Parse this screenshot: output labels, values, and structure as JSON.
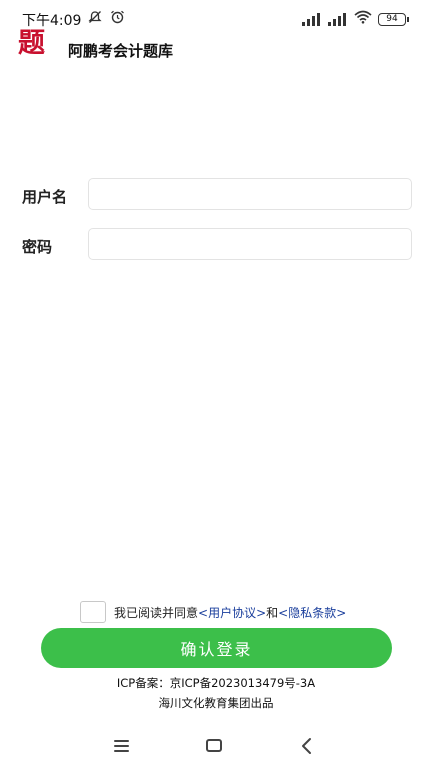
{
  "status_bar": {
    "time": "下午4:09",
    "battery": "94"
  },
  "app": {
    "logo_char": "题",
    "title": "阿鹏考会计题库"
  },
  "form": {
    "username_label": "用户名",
    "username_value": "",
    "password_label": "密码",
    "password_value": ""
  },
  "agreement": {
    "prefix": "我已阅读并同意",
    "user_agreement": "<用户协议>",
    "and": "和",
    "privacy_policy": "<隐私条款>",
    "checked": false
  },
  "confirm_label": "确认登录",
  "footer": {
    "icp": "ICP备案：京ICP备2023013479号-3A",
    "company": "海川文化教育集团出品"
  },
  "colors": {
    "primary_green": "#3cbf4a",
    "logo_red": "#c8102e",
    "link_blue": "#1a3e9c"
  },
  "icons": {
    "status_left": [
      "mute-icon",
      "alarm-icon"
    ],
    "status_right": [
      "signal-icon",
      "signal-icon",
      "wifi-icon",
      "battery-icon"
    ],
    "nav": [
      "menu-icon",
      "home-icon",
      "back-icon"
    ]
  }
}
